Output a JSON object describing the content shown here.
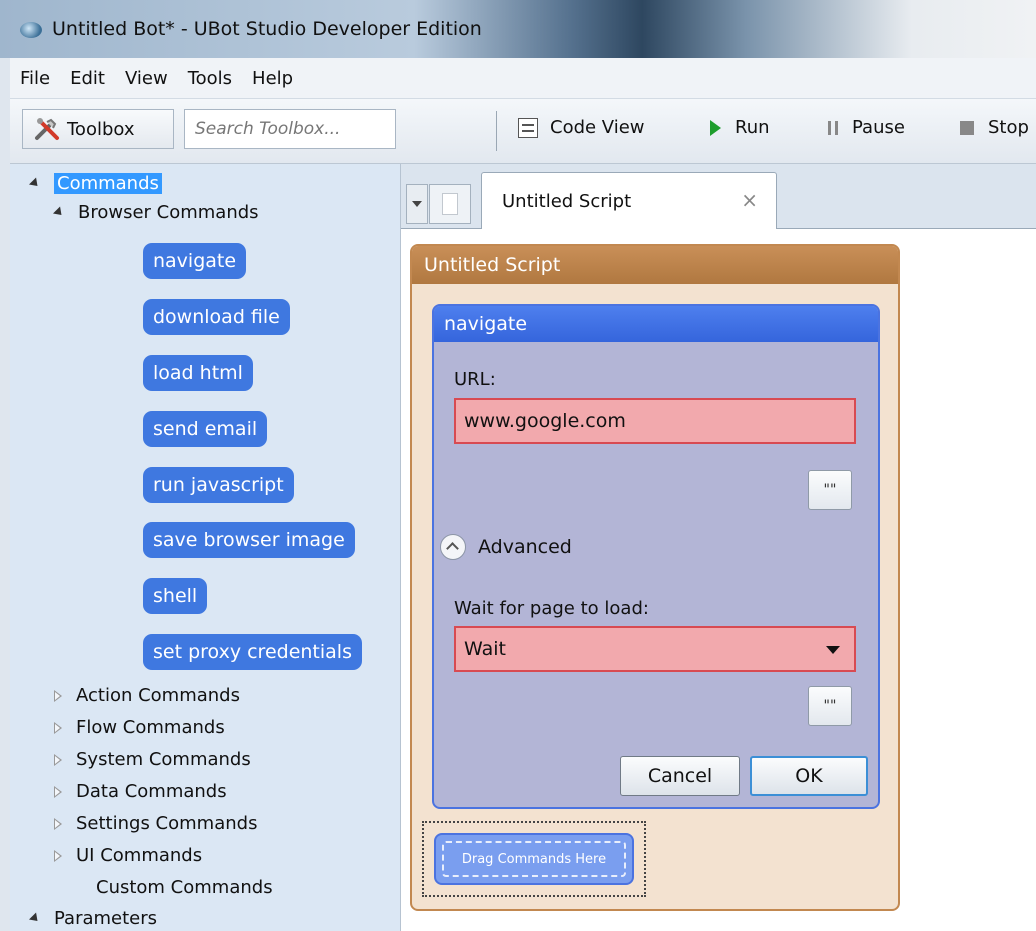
{
  "window": {
    "title": "Untitled Bot* - UBot Studio Developer Edition"
  },
  "menu": [
    "File",
    "Edit",
    "View",
    "Tools",
    "Help"
  ],
  "toolbar": {
    "toolbox_label": "Toolbox",
    "search_placeholder": "Search Toolbox...",
    "code_view_label": "Code View",
    "run_label": "Run",
    "pause_label": "Pause",
    "stop_label": "Stop"
  },
  "tree": {
    "commands_label": "Commands",
    "browser_commands_label": "Browser Commands",
    "browser_commands": [
      "navigate",
      "download file",
      "load html",
      "send email",
      "run javascript",
      "save browser image",
      "shell",
      "set proxy credentials"
    ],
    "collapsed_groups": [
      "Action Commands",
      "Flow Commands",
      "System Commands",
      "Data Commands",
      "Settings Commands",
      "UI Commands"
    ],
    "custom_commands_label": "Custom Commands",
    "parameters_label": "Parameters"
  },
  "tabs": [
    {
      "label": "Untitled Script",
      "close": "×"
    }
  ],
  "script": {
    "title": "Untitled Script",
    "command_title": "navigate",
    "url_label": "URL:",
    "url_value": "www.google.com",
    "quote_button": "\"\"",
    "advanced_label": "Advanced",
    "wait_label": "Wait for page to load:",
    "wait_value": "Wait",
    "cancel_label": "Cancel",
    "ok_label": "OK",
    "drag_placeholder": "Drag Commands Here"
  },
  "colors": {
    "command_pill": "#3f78e0",
    "script_header": "#b97f48",
    "command_header": "#3f6fe4",
    "invalid_field": "#f2a9ad",
    "selection": "#3399ff"
  }
}
